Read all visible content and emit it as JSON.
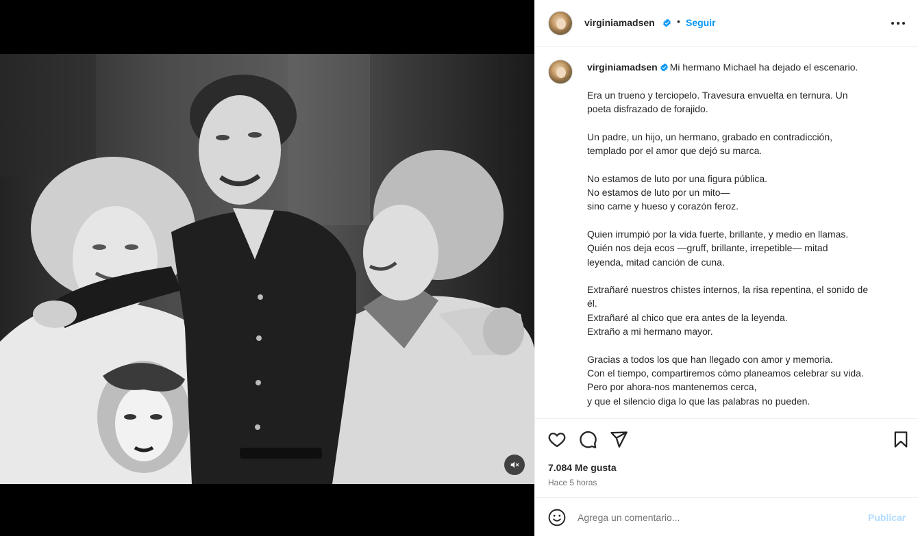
{
  "post": {
    "username": "virginiamadsen",
    "follow_label": "Seguir",
    "dot": "•",
    "caption_first": "Mi hermano Michael ha dejado el escenario.",
    "caption_lines": [
      "Era un trueno y terciopelo. Travesura envuelta en ternura. Un",
      "poeta disfrazado de forajido.",
      "",
      "Un padre, un hijo, un hermano, grabado en contradicción,",
      "templado por el amor que dejó su marca.",
      "",
      "No estamos de luto por una figura pública.",
      "No estamos de luto por un mito—",
      "sino carne y hueso y corazón feroz.",
      "",
      "Quien irrumpió por la vida fuerte, brillante, y medio en llamas.",
      "Quién nos deja ecos —gruff, brillante, irrepetible— mitad",
      "leyenda, mitad canción de cuna.",
      "",
      "Extrañaré nuestros chistes internos, la risa repentina, el sonido de",
      "él.",
      "Extrañaré al chico que era antes de la leyenda.",
      "Extraño a mi hermano mayor.",
      "",
      "Gracias a todos los que han llegado con amor y memoria.",
      "Con el tiempo, compartiremos cómo planeamos celebrar su vida.",
      "Pero por ahora-nos mantenemos cerca,",
      "y que el silencio diga lo que las palabras no pueden."
    ],
    "likes": "7.084 Me gusta",
    "time": "Hace 5 horas"
  },
  "comment": {
    "placeholder": "Agrega un comentario...",
    "publish_label": "Publicar"
  },
  "icons": {
    "verified": "verified-badge-icon",
    "more": "more-options-icon",
    "like": "heart-icon",
    "comment": "comment-icon",
    "share": "share-icon",
    "save": "bookmark-icon",
    "emoji": "emoji-icon",
    "mute": "muted-speaker-icon"
  },
  "colors": {
    "accent": "#0095f6",
    "verified": "#0095f6",
    "publish_disabled": "#b3dbff",
    "text": "#262626",
    "secondary": "#737373"
  }
}
